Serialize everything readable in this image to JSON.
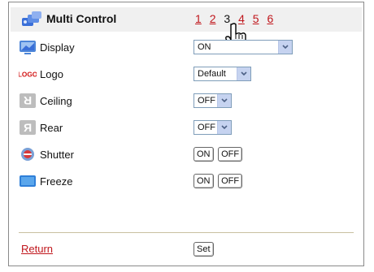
{
  "header": {
    "title": "Multi Control",
    "pages": [
      "1",
      "2",
      "3",
      "4",
      "5",
      "6"
    ],
    "current_page": "3"
  },
  "rows": [
    {
      "label": "Display",
      "icon": "display-icon",
      "control": "select",
      "value": "ON"
    },
    {
      "label": "Logo",
      "icon": "logo-icon",
      "icon_text": "LOGO",
      "control": "select",
      "value": "Default"
    },
    {
      "label": "Ceiling",
      "icon": "ceiling-icon",
      "control": "select",
      "value": "OFF"
    },
    {
      "label": "Rear",
      "icon": "rear-icon",
      "control": "select",
      "value": "OFF"
    },
    {
      "label": "Shutter",
      "icon": "shutter-icon",
      "control": "buttons",
      "on": "ON",
      "off": "OFF"
    },
    {
      "label": "Freeze",
      "icon": "freeze-icon",
      "control": "buttons",
      "on": "ON",
      "off": "OFF"
    }
  ],
  "footer": {
    "return_label": "Return",
    "set_label": "Set"
  },
  "colors": {
    "link": "#c0161c",
    "header_bg": "#f0f0f0",
    "separator": "#c9c0a0"
  }
}
